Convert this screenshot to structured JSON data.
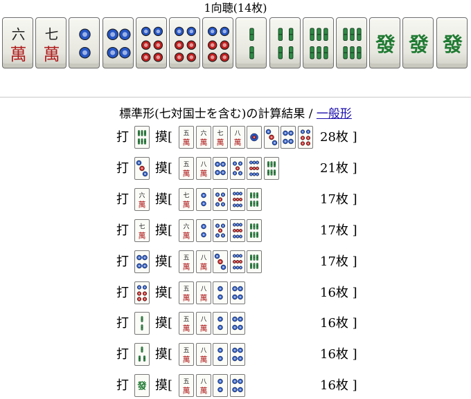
{
  "header": {
    "title": "1向聴(14枚)"
  },
  "hand": [
    "m6",
    "m7",
    "p2",
    "p4",
    "p6",
    "p6",
    "p6",
    "s2",
    "s4",
    "s6",
    "s6",
    "hatsu",
    "hatsu",
    "hatsu"
  ],
  "section": {
    "heading": "標準形(七対国士を含む)の計算結果 /",
    "link_label": "一般形"
  },
  "labels": {
    "discard": "打",
    "draw": "摸[",
    "close": "]"
  },
  "results": [
    {
      "discard": "s6",
      "draws": [
        "m5",
        "m6",
        "m7",
        "m8",
        "p1",
        "p3",
        "p4",
        "p6"
      ],
      "count": "28枚"
    },
    {
      "discard": "p3",
      "draws": [
        "m5",
        "m8",
        "p4",
        "p5",
        "p9",
        "s6"
      ],
      "count": "21枚"
    },
    {
      "discard": "m6",
      "draws": [
        "m7",
        "p2",
        "p5",
        "p9",
        "s6"
      ],
      "count": "17枚"
    },
    {
      "discard": "m7",
      "draws": [
        "m6",
        "p2",
        "p5",
        "p9",
        "s6"
      ],
      "count": "17枚"
    },
    {
      "discard": "p4",
      "draws": [
        "m5",
        "m8",
        "p3",
        "p9",
        "s6"
      ],
      "count": "17枚"
    },
    {
      "discard": "p6",
      "draws": [
        "m5",
        "m8",
        "p2",
        "p4"
      ],
      "count": "16枚"
    },
    {
      "discard": "s2",
      "draws": [
        "m5",
        "m8",
        "p2",
        "p4"
      ],
      "count": "16枚"
    },
    {
      "discard": "s3",
      "draws": [
        "m5",
        "m8",
        "p2",
        "p4"
      ],
      "count": "16枚"
    },
    {
      "discard": "hatsu",
      "draws": [
        "m5",
        "m8",
        "p2",
        "p4"
      ],
      "count": "16枚"
    }
  ]
}
